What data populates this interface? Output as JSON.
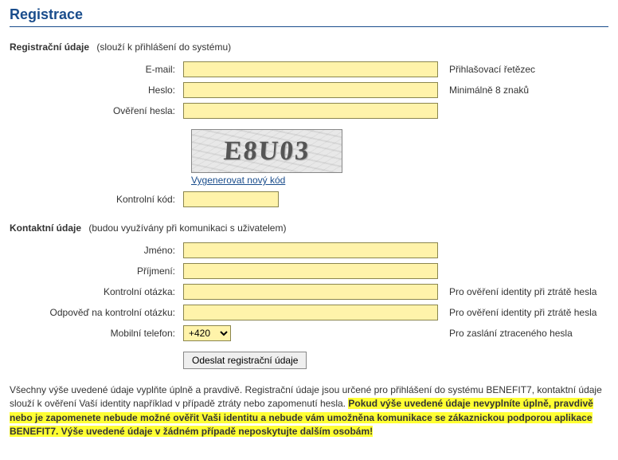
{
  "page_title": "Registrace",
  "section1": {
    "label": "Registrační údaje",
    "hint": "(slouží k přihlášení do systému)"
  },
  "fields": {
    "email": {
      "label": "E-mail:",
      "hint": "Přihlašovací řetězec"
    },
    "password": {
      "label": "Heslo:",
      "hint": "Minimálně 8 znaků"
    },
    "password_confirm": {
      "label": "Ověření hesla:"
    },
    "captcha_code": {
      "label": "Kontrolní kód:"
    },
    "first_name": {
      "label": "Jméno:"
    },
    "last_name": {
      "label": "Příjmení:"
    },
    "security_question": {
      "label": "Kontrolní otázka:",
      "hint": "Pro ověření identity při ztrátě hesla"
    },
    "security_answer": {
      "label": "Odpověď na kontrolní otázku:",
      "hint": "Pro ověření identity při ztrátě hesla"
    },
    "mobile": {
      "label": "Mobilní telefon:",
      "hint": "Pro zaslání ztraceného hesla",
      "prefix": "+420"
    }
  },
  "captcha": {
    "value": "E8U03",
    "regenerate_link": "Vygenerovat nový kód"
  },
  "section2": {
    "label": "Kontaktní údaje",
    "hint": "(budou využívány při komunikaci s uživatelem)"
  },
  "submit_label": "Odeslat registrační údaje",
  "footer": {
    "text1": "Všechny výše uvedené údaje vyplňte úplně a pravdivě. Registrační údaje jsou určené pro přihlášení do systému BENEFIT7, kontaktní údaje slouží k ověření Vaší identity například v případě ztráty nebo zapomenutí hesla. ",
    "highlight": "Pokud výše uvedené údaje nevyplníte úplně, pravdivě nebo je zapomenete nebude možné ověřit Vaši identitu a nebude vám umožněna komunikace se zákaznickou podporou aplikace BENEFIT7. Výše uvedené údaje v žádném případě neposkytujte dalším osobám!"
  }
}
